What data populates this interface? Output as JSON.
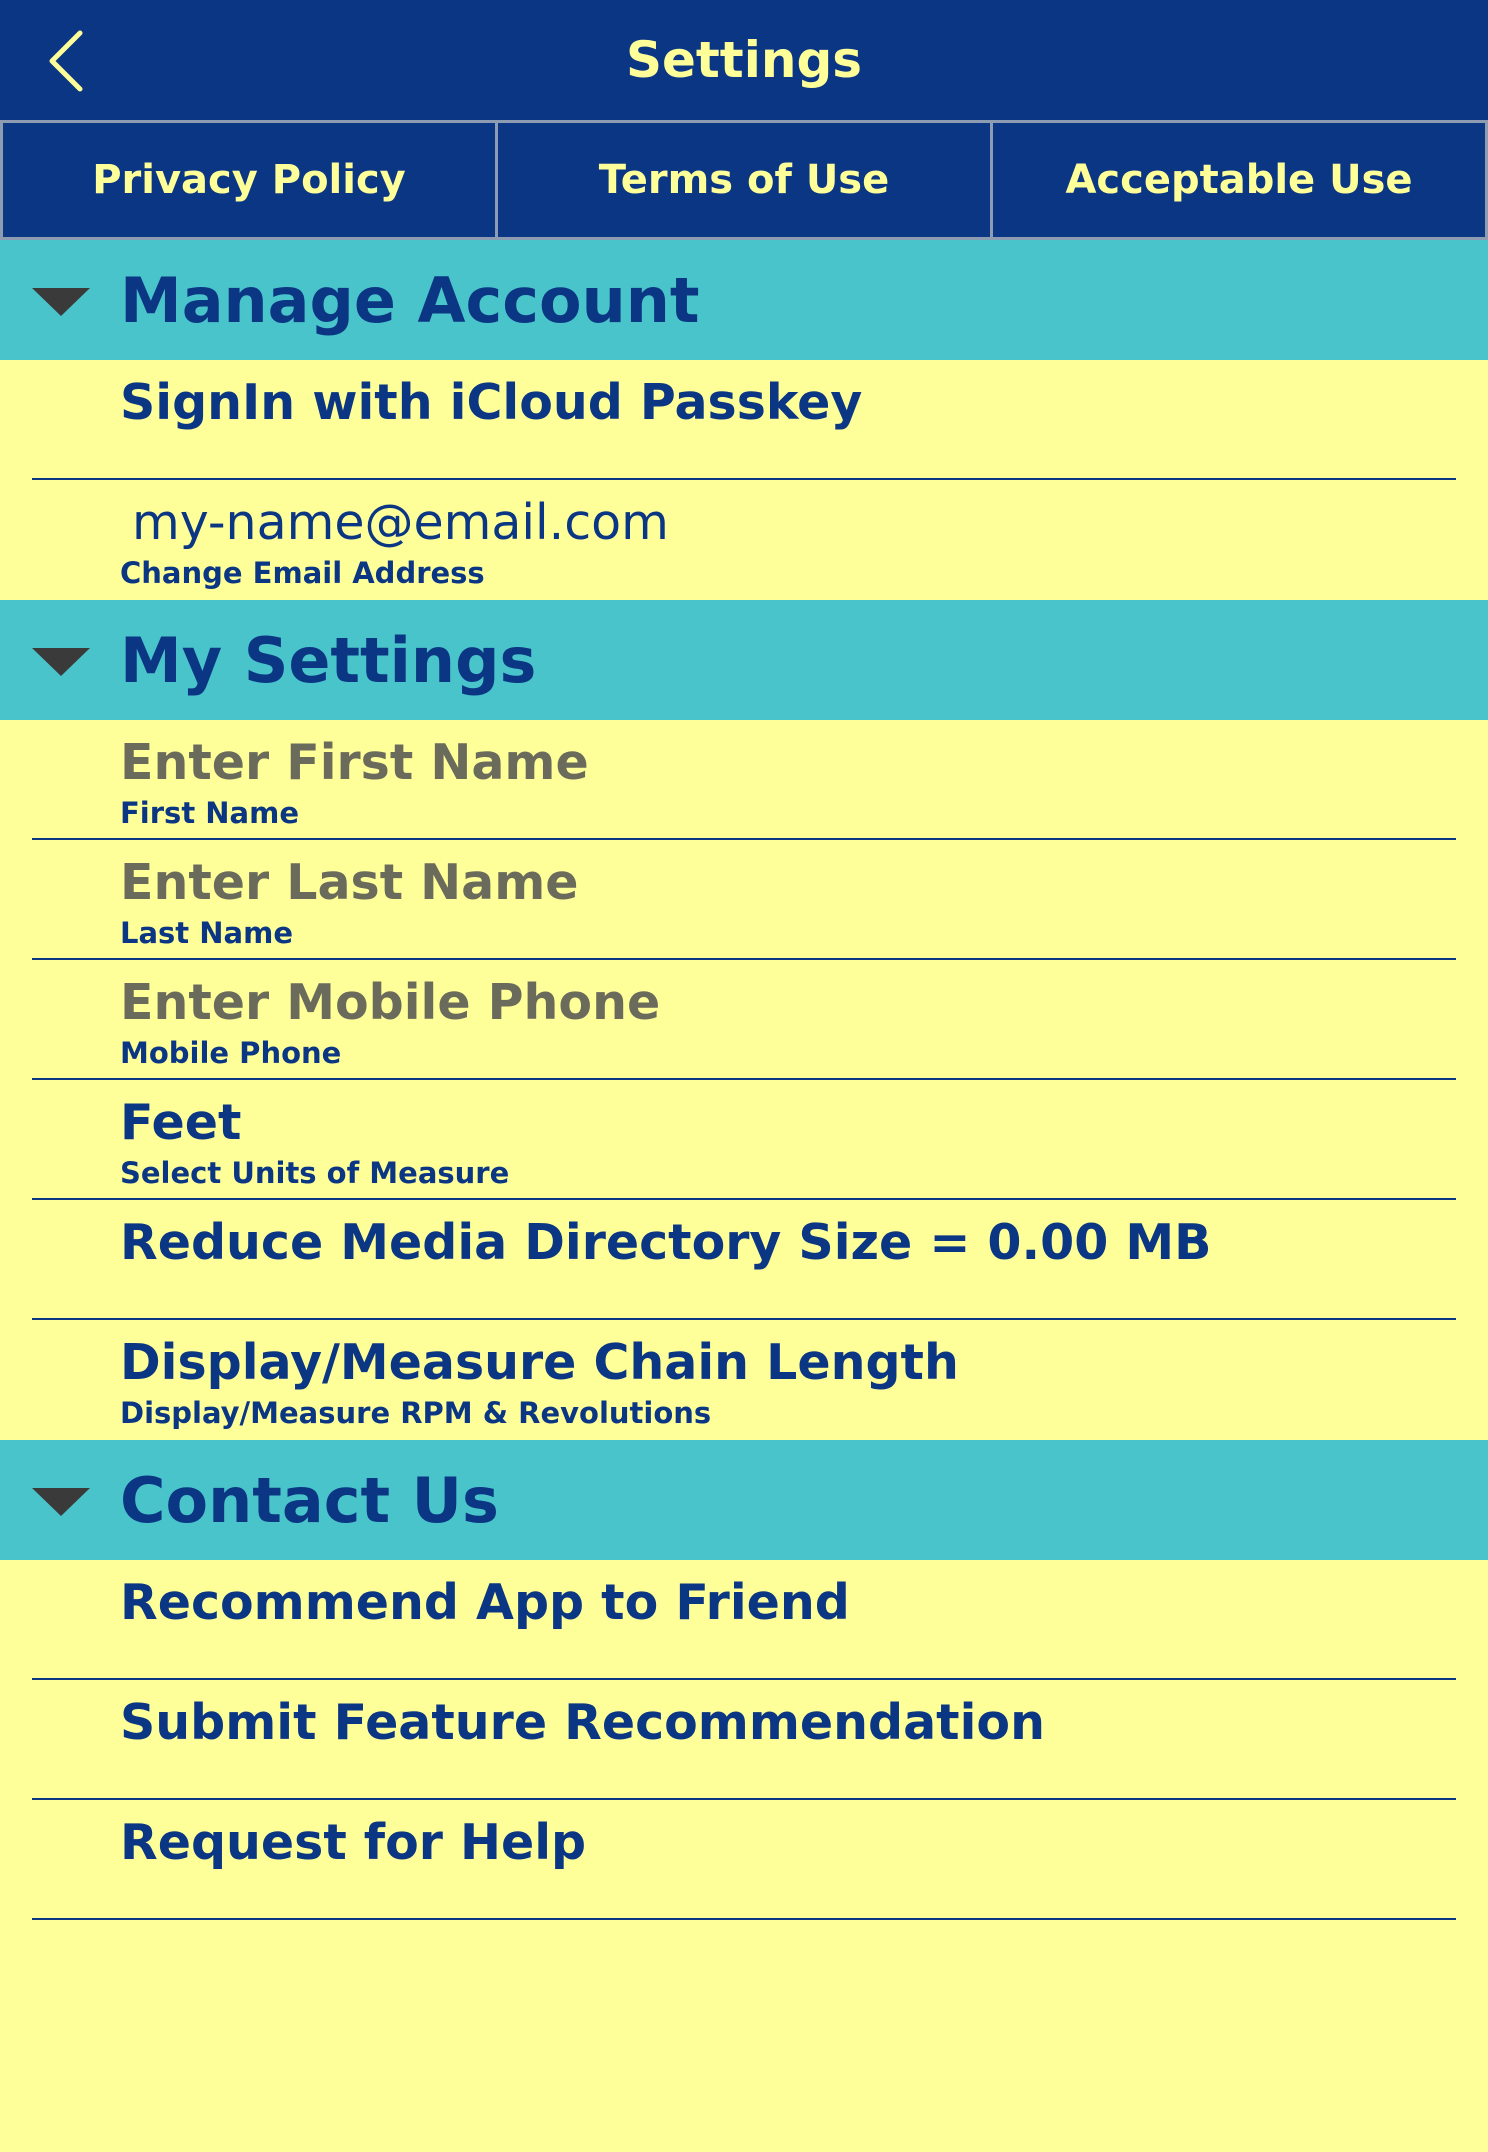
{
  "navbar": {
    "title": "Settings",
    "back_icon": "chevron-left-icon"
  },
  "tabs": [
    {
      "label": "Privacy Policy"
    },
    {
      "label": "Terms of Use"
    },
    {
      "label": "Acceptable Use"
    }
  ],
  "sections": {
    "manage_account": {
      "title": "Manage Account",
      "rows": [
        {
          "main": "SignIn with iCloud Passkey",
          "sub": ""
        },
        {
          "main": "my-name@email.com",
          "sub": "Change Email Address"
        }
      ]
    },
    "my_settings": {
      "title": "My Settings",
      "rows": [
        {
          "placeholder": "Enter First Name",
          "sub": "First Name"
        },
        {
          "placeholder": "Enter Last Name",
          "sub": "Last Name"
        },
        {
          "placeholder": "Enter Mobile Phone",
          "sub": "Mobile Phone"
        },
        {
          "main": "Feet",
          "sub": "Select Units of Measure"
        },
        {
          "main": "Reduce Media Directory Size = 0.00 MB",
          "sub": ""
        },
        {
          "main": "Display/Measure Chain Length",
          "sub": "Display/Measure RPM & Revolutions"
        }
      ]
    },
    "contact_us": {
      "title": "Contact Us",
      "rows": [
        {
          "main": "Recommend App to Friend"
        },
        {
          "main": "Submit Feature Recommendation"
        },
        {
          "main": "Request for Help"
        }
      ]
    }
  },
  "colors": {
    "navbar_bg": "#0b3683",
    "accent_text": "#ffff99",
    "section_bg": "#4ac4cb",
    "page_bg": "#ffff99",
    "primary_text": "#0b3683",
    "placeholder_text": "#6b6b5c"
  }
}
